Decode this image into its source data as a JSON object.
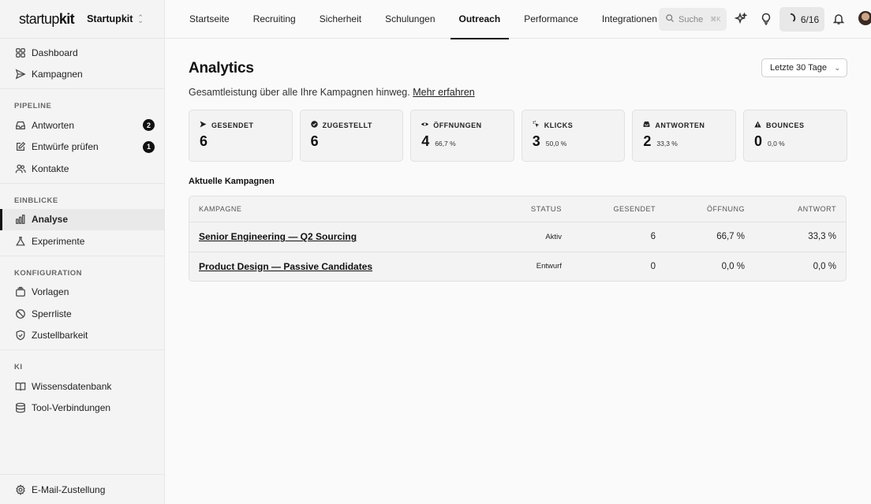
{
  "brand": {
    "logo_light": "startup",
    "logo_bold": "kit",
    "workspace": "Startupkit"
  },
  "sidebar": {
    "top_items": [
      {
        "label": "Dashboard",
        "icon": "grid-icon"
      },
      {
        "label": "Kampagnen",
        "icon": "send-icon"
      }
    ],
    "groups": [
      {
        "label": "PIPELINE",
        "items": [
          {
            "label": "Antworten",
            "icon": "inbox-icon",
            "badge": "2"
          },
          {
            "label": "Entwürfe prüfen",
            "icon": "edit-icon",
            "badge": "1"
          },
          {
            "label": "Kontakte",
            "icon": "users-icon"
          }
        ]
      },
      {
        "label": "EINBLICKE",
        "items": [
          {
            "label": "Analyse",
            "icon": "bar-chart-icon",
            "active": true
          },
          {
            "label": "Experimente",
            "icon": "flask-icon"
          }
        ]
      },
      {
        "label": "KONFIGURATION",
        "items": [
          {
            "label": "Vorlagen",
            "icon": "layers-icon"
          },
          {
            "label": "Sperrliste",
            "icon": "ban-icon"
          },
          {
            "label": "Zustellbarkeit",
            "icon": "shield-check-icon"
          }
        ]
      },
      {
        "label": "KI",
        "items": [
          {
            "label": "Wissensdatenbank",
            "icon": "book-icon"
          },
          {
            "label": "Tool-Verbindungen",
            "icon": "database-icon"
          }
        ]
      }
    ],
    "bottom_item": {
      "label": "E-Mail-Zustellung",
      "icon": "gear-icon"
    }
  },
  "topnav": {
    "tabs": [
      "Startseite",
      "Recruiting",
      "Sicherheit",
      "Schulungen",
      "Outreach",
      "Performance",
      "Integrationen"
    ],
    "active_tab": "Outreach",
    "search_placeholder": "Suche",
    "search_shortcut": "⌘K",
    "progress": "6/16"
  },
  "page": {
    "title": "Analytics",
    "subtitle": "Gesamtleistung über alle Ihre Kampagnen hinweg.",
    "learn_more": "Mehr erfahren",
    "range": "Letzte 30 Tage"
  },
  "stats": [
    {
      "label": "GESENDET",
      "value": "6",
      "pct": "",
      "icon": "send-icon"
    },
    {
      "label": "ZUGESTELLT",
      "value": "6",
      "pct": "",
      "icon": "check-circle-icon"
    },
    {
      "label": "ÖFFNUNGEN",
      "value": "4",
      "pct": "66,7 %",
      "icon": "eye-icon"
    },
    {
      "label": "KLICKS",
      "value": "3",
      "pct": "50,0 %",
      "icon": "click-icon"
    },
    {
      "label": "ANTWORTEN",
      "value": "2",
      "pct": "33,3 %",
      "icon": "inbox-icon"
    },
    {
      "label": "BOUNCES",
      "value": "0",
      "pct": "0,0 %",
      "icon": "warning-icon"
    }
  ],
  "campaigns": {
    "title": "Aktuelle Kampagnen",
    "columns": [
      "KAMPAGNE",
      "STATUS",
      "GESENDET",
      "ÖFFNUNG",
      "ANTWORT"
    ],
    "rows": [
      {
        "name": "Senior Engineering — Q2 Sourcing",
        "status": "Aktiv",
        "sent": "6",
        "open": "66,7 %",
        "reply": "33,3 %"
      },
      {
        "name": "Product Design — Passive Candidates",
        "status": "Entwurf",
        "sent": "0",
        "open": "0,0 %",
        "reply": "0,0 %"
      }
    ]
  }
}
